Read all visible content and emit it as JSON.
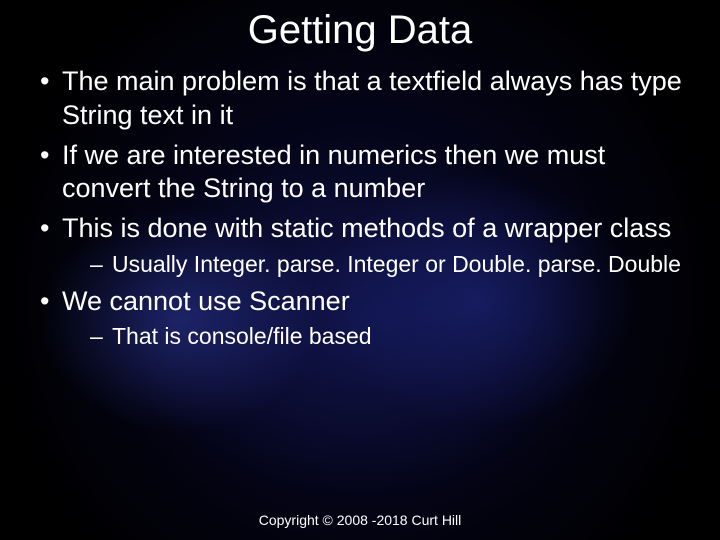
{
  "title": "Getting Data",
  "bullets": [
    {
      "text": "The main problem is that a textfield always has type String text in it",
      "sub": []
    },
    {
      "text": "If we are interested in numerics then we must convert the String to a number",
      "sub": []
    },
    {
      "text": "This is done with static methods of a wrapper class",
      "sub": [
        "Usually Integer. parse. Integer or Double. parse. Double"
      ]
    },
    {
      "text": "We cannot use Scanner",
      "sub": [
        "That is console/file based"
      ]
    }
  ],
  "footer": "Copyright © 2008 -2018 Curt Hill"
}
